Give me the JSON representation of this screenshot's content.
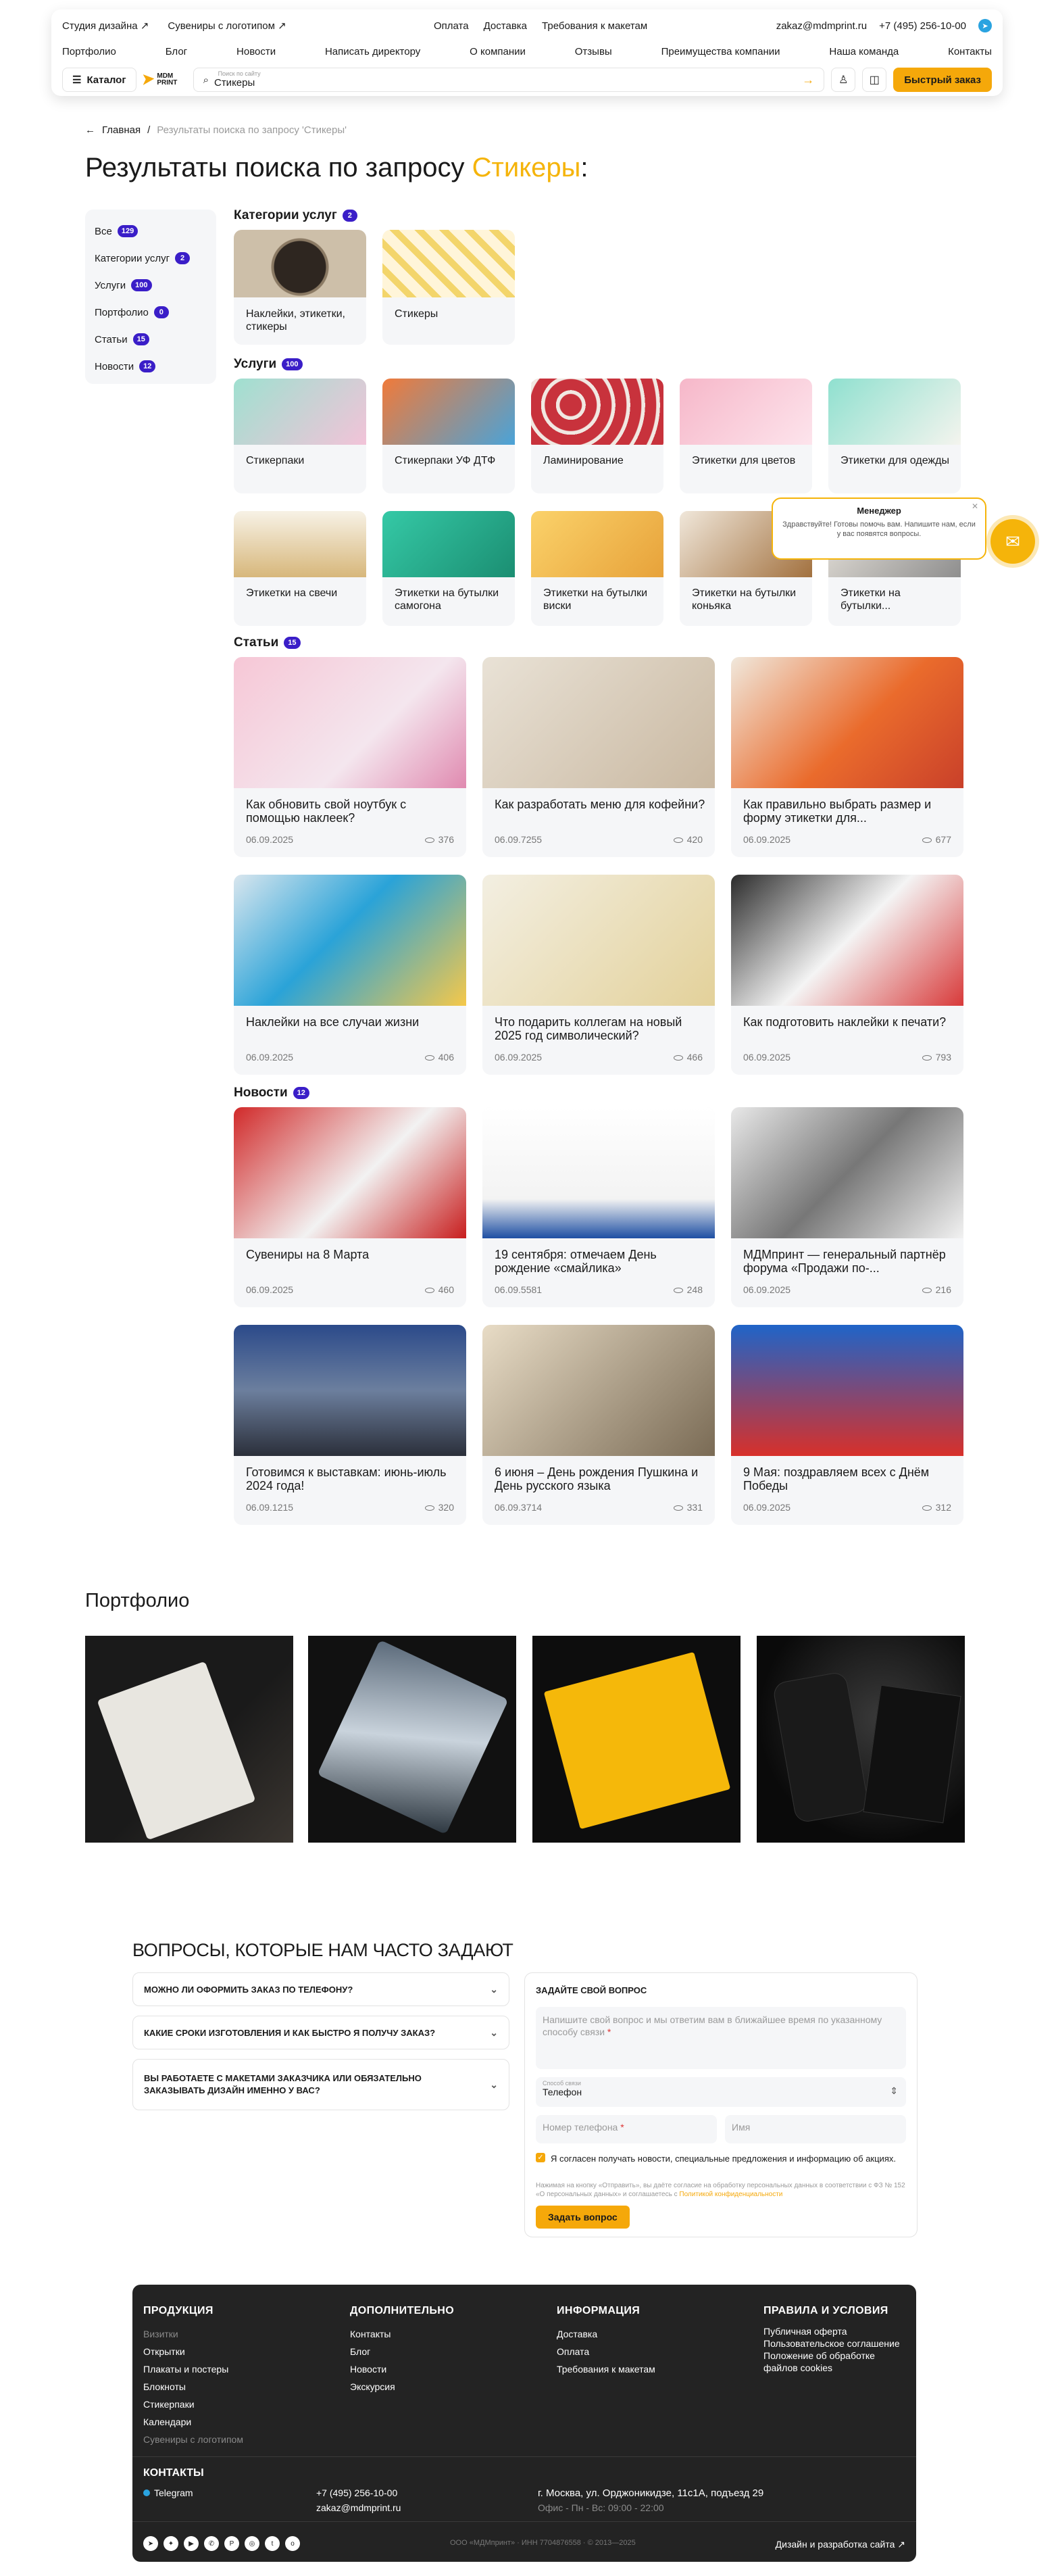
{
  "header": {
    "top_left": [
      "Студия дизайна ↗",
      "Сувениры с логотипом ↗"
    ],
    "top_mid": [
      "Оплата",
      "Доставка",
      "Требования к макетам"
    ],
    "email": "zakaz@mdmprint.ru",
    "phone": "+7 (495) 256-10-00",
    "nav": [
      "Портфолио",
      "Блог",
      "Новости",
      "Написать директору",
      "О компании",
      "Отзывы",
      "Преимущества компании",
      "Наша команда",
      "Контакты"
    ],
    "catalog": "Каталог",
    "logo": "MDM PRINT",
    "search_label": "Поиск по сайту",
    "search_value": "Стикеры",
    "fast_order": "Быстрый заказ"
  },
  "breadcrumb": {
    "home": "Главная",
    "current": "Результаты поиска по запросу 'Стикеры'"
  },
  "title": {
    "prefix": "Результаты поиска по запросу",
    "query": "Стикеры"
  },
  "filters": [
    {
      "label": "Все",
      "count": "129"
    },
    {
      "label": "Категории услуг",
      "count": "2"
    },
    {
      "label": "Услуги",
      "count": "100"
    },
    {
      "label": "Портфолио",
      "count": "0"
    },
    {
      "label": "Статьи",
      "count": "15"
    },
    {
      "label": "Новости",
      "count": "12"
    }
  ],
  "sections": {
    "categories": {
      "label": "Категории услуг",
      "count": "2"
    },
    "services": {
      "label": "Услуги",
      "count": "100"
    },
    "articles": {
      "label": "Статьи",
      "count": "15"
    },
    "news": {
      "label": "Новости",
      "count": "12"
    }
  },
  "categories": [
    "Наклейки, этикетки, стикеры",
    "Стикеры"
  ],
  "services": [
    "Стикерпаки",
    "Стикерпаки УФ ДТФ",
    "Ламинирование",
    "Этикетки для цветов",
    "Этикетки для одежды",
    "Этикетки на свечи",
    "Этикетки на бутылки самогона",
    "Этикетки на бутылки виски",
    "Этикетки на бутылки коньяка",
    "Этикетки на бутылки..."
  ],
  "articles": [
    {
      "title": "Как обновить свой ноутбук с помощью наклеек?",
      "date": "06.09.2025",
      "views": "376"
    },
    {
      "title": "Как разработать меню для кофейни?",
      "date": "06.09.7255",
      "views": "420"
    },
    {
      "title": "Как правильно выбрать размер и форму этикетки для...",
      "date": "06.09.2025",
      "views": "677"
    },
    {
      "title": "Наклейки на все случаи жизни",
      "date": "06.09.2025",
      "views": "406"
    },
    {
      "title": "Что подарить коллегам на новый 2025 год символический?",
      "date": "06.09.2025",
      "views": "466"
    },
    {
      "title": "Как подготовить наклейки к печати?",
      "date": "06.09.2025",
      "views": "793"
    }
  ],
  "news": [
    {
      "title": "Сувениры на 8 Марта",
      "date": "06.09.2025",
      "views": "460"
    },
    {
      "title": "19 сентября: отмечаем День рождение «смайлика»",
      "date": "06.09.5581",
      "views": "248"
    },
    {
      "title": "МДМпринт — генеральный партнёр форума «Продажи по-...",
      "date": "06.09.2025",
      "views": "216"
    },
    {
      "title": "Готовимся к выставкам: июнь-июль 2024 года!",
      "date": "06.09.1215",
      "views": "320"
    },
    {
      "title": "6 июня – День рождения Пушкина и День русского языка",
      "date": "06.09.3714",
      "views": "331"
    },
    {
      "title": "9 Мая: поздравляем всех с Днём Победы",
      "date": "06.09.2025",
      "views": "312"
    }
  ],
  "portfolio_title": "Портфолио",
  "faq": {
    "title": "ВОПРОСЫ, КОТОРЫЕ НАМ ЧАСТО ЗАДАЮТ",
    "items": [
      "Можно ли оформить заказ по телефону?",
      "Какие сроки изготовления и как быстро я получу заказ?",
      "Вы работаете с макетами заказчика или обязательно заказывать дизайн именно у вас?"
    ]
  },
  "ask": {
    "title": "ЗАДАЙТЕ СВОЙ ВОПРОС",
    "question_placeholder": "Напишите свой вопрос и мы ответим вам в ближайшее время по указанному способу связи",
    "contact_label": "Способ связи",
    "contact_value": "Телефон",
    "phone_placeholder": "Номер телефона",
    "name_placeholder": "Имя",
    "consent": "Я согласен получать новости, специальные предложения и информацию об акциях.",
    "legal": "Нажимая на кнопку «Отправить», вы даёте согласие на обработку персональных данных в соответствии с ФЗ № 152 «О персональных данных» и соглашаетесь с",
    "legal_link": "Политикой конфиденциальности",
    "submit": "Задать вопрос"
  },
  "manager": {
    "title": "Менеджер",
    "text": "Здравствуйте! Готовы помочь вам. Напишите нам, если у вас появятся вопросы."
  },
  "footer": {
    "col1": {
      "title": "ПРОДУКЦИЯ",
      "items": [
        "Визитки",
        "Открытки",
        "Плакаты и постеры",
        "Блокноты",
        "Стикерпаки",
        "Календари",
        "Сувениры с логотипом"
      ]
    },
    "col2": {
      "title": "ДОПОЛНИТЕЛЬНО",
      "items": [
        "Контакты",
        "Блог",
        "Новости",
        "Экскурсия"
      ]
    },
    "col3": {
      "title": "ИНФОРМАЦИЯ",
      "items": [
        "Доставка",
        "Оплата",
        "Требования к макетам"
      ]
    },
    "col4": {
      "title": "ПРАВИЛА И УСЛОВИЯ",
      "items": [
        "Публичная оферта",
        "Пользовательское соглашение",
        "Положение об обработке файлов cookies"
      ]
    },
    "contacts_title": "КОНТАКТЫ",
    "telegram": "Telegram",
    "phone": "+7 (495) 256-10-00",
    "email": "zakaz@mdmprint.ru",
    "address": "г. Москва, ул. Орджоникидзе, 11с1А, подъезд 29",
    "hours": "Офис - Пн - Вс: 09:00 - 22:00",
    "legal": "ООО «МДМпринт» · ИНН 7704876558 · © 2013—2025",
    "design": "Дизайн и разработка сайта ↗"
  }
}
